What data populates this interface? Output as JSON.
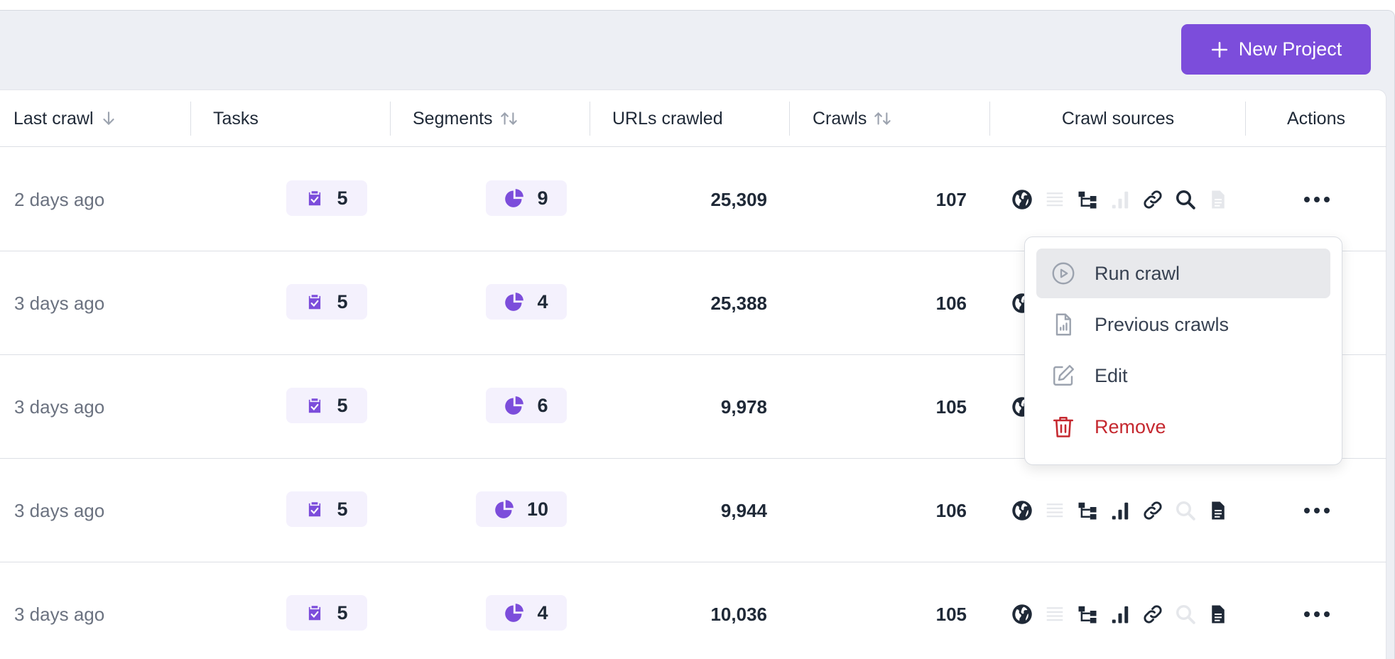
{
  "toolbar": {
    "new_project_label": "New Project"
  },
  "columns": {
    "last_crawl": "Last crawl",
    "tasks": "Tasks",
    "segments": "Segments",
    "urls_crawled": "URLs crawled",
    "crawls": "Crawls",
    "crawl_sources": "Crawl sources",
    "actions": "Actions"
  },
  "rows": [
    {
      "last_crawl": "2 days ago",
      "tasks": "5",
      "segments": "9",
      "urls": "25,309",
      "crawls": "107",
      "sources": {
        "list": false,
        "analytics": false,
        "search": true,
        "doc": false
      }
    },
    {
      "last_crawl": "3 days ago",
      "tasks": "5",
      "segments": "4",
      "urls": "25,388",
      "crawls": "106",
      "sources": {
        "list": false,
        "analytics": true,
        "search": false,
        "doc": true
      }
    },
    {
      "last_crawl": "3 days ago",
      "tasks": "5",
      "segments": "6",
      "urls": "9,978",
      "crawls": "105",
      "sources": {
        "list": false,
        "analytics": true,
        "search": false,
        "doc": true
      }
    },
    {
      "last_crawl": "3 days ago",
      "tasks": "5",
      "segments": "10",
      "urls": "9,944",
      "crawls": "106",
      "sources": {
        "list": false,
        "analytics": true,
        "search": false,
        "doc": true
      }
    },
    {
      "last_crawl": "3 days ago",
      "tasks": "5",
      "segments": "4",
      "urls": "10,036",
      "crawls": "105",
      "sources": {
        "list": false,
        "analytics": true,
        "search": false,
        "doc": true
      }
    }
  ],
  "menu": {
    "run_crawl": "Run crawl",
    "previous_crawls": "Previous crawls",
    "edit": "Edit",
    "remove": "Remove"
  },
  "colors": {
    "accent": "#7c4ddb",
    "danger": "#c5282f",
    "pill_bg": "#f4f1fd"
  }
}
